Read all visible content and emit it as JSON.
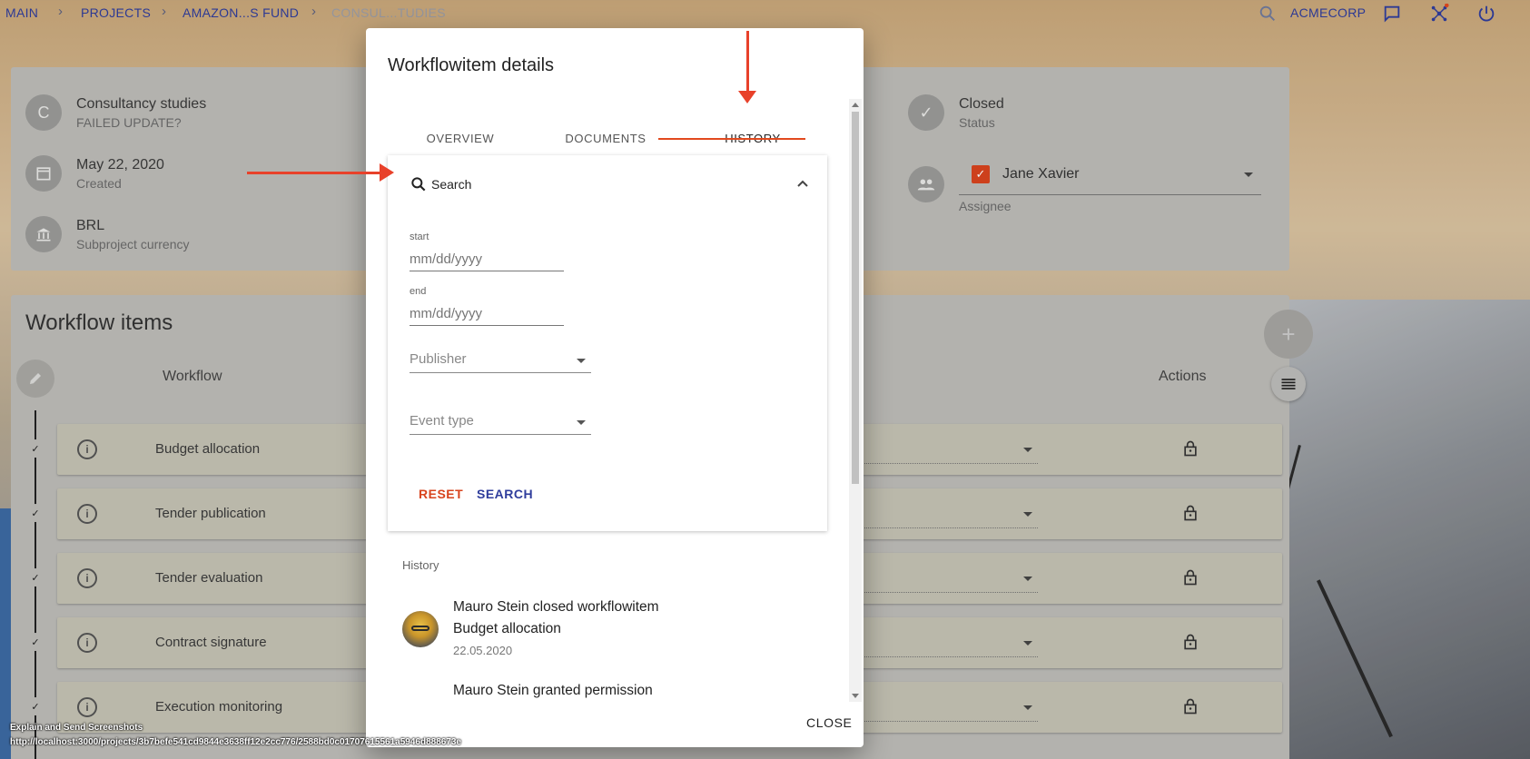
{
  "breadcrumbs": [
    "MAIN",
    "PROJECTS",
    "AMAZON...S FUND",
    "CONSUL...TUDIES"
  ],
  "topbar": {
    "org": "ACMECORP"
  },
  "subproject": {
    "avatar_letter": "C",
    "name": "Consultancy studies",
    "name_sub": "FAILED UPDATE?",
    "date": "May 22, 2020",
    "date_sub": "Created",
    "currency": "BRL",
    "currency_sub": "Subproject currency",
    "status": "Closed",
    "status_sub": "Status",
    "assignee": "Jane Xavier",
    "assignee_sub": "Assignee"
  },
  "workflow": {
    "title": "Workflow items",
    "col_workflow": "Workflow",
    "col_actions": "Actions",
    "items": [
      {
        "name": "Budget allocation"
      },
      {
        "name": "Tender publication"
      },
      {
        "name": "Tender evaluation"
      },
      {
        "name": "Contract signature"
      },
      {
        "name": "Execution monitoring"
      }
    ]
  },
  "dialog": {
    "title": "Workflowitem details",
    "tabs": [
      "OVERVIEW",
      "DOCUMENTS",
      "HISTORY"
    ],
    "active_tab": "HISTORY",
    "search": {
      "label": "Search",
      "start_label": "start",
      "start_placeholder": "mm/dd/yyyy",
      "end_label": "end",
      "end_placeholder": "mm/dd/yyyy",
      "publisher": "Publisher",
      "event_type": "Event type",
      "reset": "RESET",
      "submit": "SEARCH"
    },
    "history": {
      "heading": "History",
      "events": [
        {
          "line1": "Mauro Stein closed workflowitem",
          "line2": "Budget allocation",
          "date": "22.05.2020"
        },
        {
          "line1": "Mauro Stein granted permission"
        }
      ]
    },
    "close": "CLOSE"
  },
  "footer": {
    "title": "Explain and Send Screenshots",
    "url": "http://localhost:3000/projects/3b7befe541cd9844e3638ff12e2cc776/2588bd0c01707615561a5946d888673e"
  },
  "colors": {
    "accent": "#e2491e",
    "primary": "#2f3d9c",
    "annotation": "#e8412a"
  }
}
